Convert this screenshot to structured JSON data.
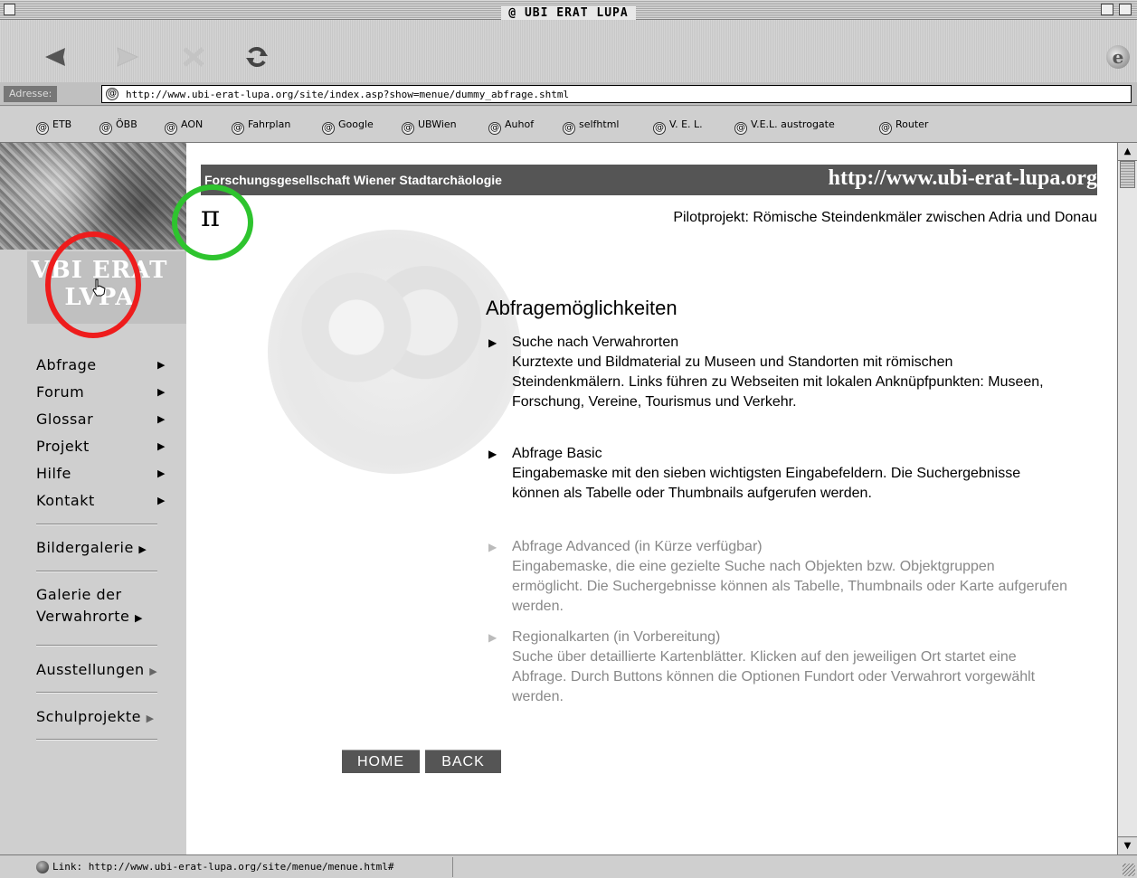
{
  "window": {
    "title": "@ UBI ERAT LUPA"
  },
  "toolbar": {
    "back_icon": "back-arrow-icon",
    "forward_icon": "forward-arrow-icon",
    "stop_icon": "stop-x-icon",
    "refresh_icon": "refresh-icon",
    "brand_icon": "ie-logo-icon",
    "brand_glyph": "e"
  },
  "address": {
    "label": "Adresse:",
    "url": "http://www.ubi-erat-lupa.org/site/index.asp?show=menue/dummy_abfrage.shtml"
  },
  "favorites": [
    "ETB",
    "ÖBB",
    "AON",
    "Fahrplan",
    "Google",
    "UBWien",
    "Auhof",
    "selfhtml",
    "V. E. L.",
    "V.E.L. austrogate",
    "Router"
  ],
  "favorite_glyph": "@",
  "sidebar": {
    "logo_line1": "VBI ERAT",
    "logo_line2": "LVPA",
    "menu": [
      {
        "label": "Abfrage",
        "arrow": "▶"
      },
      {
        "label": "Forum",
        "arrow": "▶"
      },
      {
        "label": "Glossar",
        "arrow": "▶"
      },
      {
        "label": "Projekt",
        "arrow": "▶"
      },
      {
        "label": "Hilfe",
        "arrow": "▶"
      },
      {
        "label": "Kontakt",
        "arrow": "▶"
      }
    ],
    "bildergalerie": "Bildergalerie",
    "galerie_line1": "Galerie der",
    "galerie_line2": "Verwahrorte",
    "ausstellungen": "Ausstellungen",
    "schulprojekte": "Schulprojekte",
    "arrow": "▶"
  },
  "header": {
    "left": "Forschungsgesellschaft Wiener Stadtarchäologie",
    "right": "http://www.ubi-erat-lupa.org",
    "pi": "π",
    "subtitle": "Pilotprojekt: Römische Steindenkmäler zwischen Adria und Donau"
  },
  "main": {
    "title": "Abfragemöglichkeiten",
    "entries": [
      {
        "bullet": "▶",
        "heading": "Suche nach Verwahrorten",
        "text": "Kurztexte und Bildmaterial zu Museen und Standorten mit römischen Steindenkmälern. Links führen zu Webseiten mit lokalen Anknüpfpunkten: Museen, Forschung, Vereine, Tourismus und Verkehr."
      },
      {
        "bullet": "▶",
        "heading": "Abfrage Basic",
        "text": "Eingabemaske mit den sieben wichtigsten Eingabefeldern. Die Suchergebnisse können als Tabelle oder Thumbnails aufgerufen werden."
      },
      {
        "bullet": "▶",
        "heading": "Abfrage Advanced (in Kürze verfügbar)",
        "text": "Eingabemaske, die eine gezielte Suche nach Objekten bzw. Objektgruppen ermöglicht. Die Suchergebnisse können als Tabelle, Thumbnails oder Karte aufgerufen werden."
      },
      {
        "bullet": "▶",
        "heading": "Regionalkarten (in Vorbereitung)",
        "text": "Suche über detaillierte Kartenblätter. Klicken auf den jeweiligen Ort startet eine Abfrage. Durch Buttons können die Optionen Fundort oder Verwahrort vorgewählt werden."
      }
    ],
    "home_button": "HOME",
    "back_button": "BACK"
  },
  "status": {
    "text": "Link: http://www.ubi-erat-lupa.org/site/menue/menue.html#"
  },
  "annotations": {
    "red_circle_color": "#ee1c1c",
    "green_circle_color": "#2ec42e"
  }
}
